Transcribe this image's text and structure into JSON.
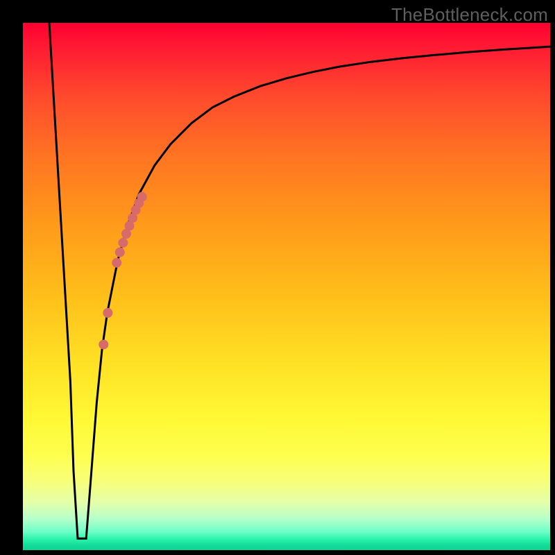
{
  "watermark": "TheBottleneck.com",
  "colors": {
    "background": "#000000",
    "curve_stroke": "#000000",
    "marker_fill": "#d76b6b",
    "watermark": "#5f5f5f"
  },
  "chart_data": {
    "type": "line",
    "title": "",
    "xlabel": "",
    "ylabel": "",
    "xlim": [
      0,
      100
    ],
    "ylim": [
      0,
      100
    ],
    "grid": false,
    "legend": false,
    "series": [
      {
        "name": "bottleneck-curve",
        "x": [
          5,
          6,
          7,
          8,
          9,
          9.6,
          10.4,
          11.2,
          12,
          13,
          14,
          15,
          16,
          18,
          20,
          22,
          25,
          28,
          32,
          36,
          40,
          45,
          50,
          55,
          60,
          66,
          72,
          78,
          85,
          92,
          100
        ],
        "y": [
          100,
          83,
          66,
          49,
          32,
          15,
          2.2,
          2.2,
          2.2,
          15,
          28,
          38,
          45,
          55,
          62,
          67.5,
          73,
          77,
          81,
          84,
          86,
          88,
          89.5,
          90.7,
          91.7,
          92.6,
          93.3,
          93.9,
          94.5,
          95,
          95.5
        ]
      }
    ],
    "markers": {
      "name": "highlighted-points",
      "x": [
        15.3,
        16.1,
        17.8,
        18.4,
        19.0,
        19.6,
        20.2,
        20.8,
        21.4,
        22.0,
        22.6
      ],
      "y": [
        39,
        45,
        54.5,
        56.5,
        58.3,
        60.0,
        61.5,
        63.0,
        64.5,
        65.8,
        67.0
      ],
      "radius": 7
    },
    "gradient_stops": [
      {
        "pos": 0,
        "color": "#ff0030"
      },
      {
        "pos": 25,
        "color": "#ff7322"
      },
      {
        "pos": 52,
        "color": "#ffbf1a"
      },
      {
        "pos": 82,
        "color": "#feff4e"
      },
      {
        "pos": 100,
        "color": "#0fd493"
      }
    ]
  }
}
